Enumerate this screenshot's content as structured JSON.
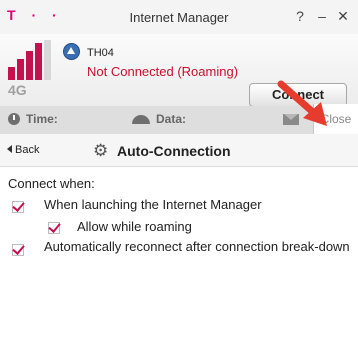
{
  "window": {
    "brand": "T · ·",
    "title": "Internet Manager",
    "help": "?",
    "minimize": "–",
    "close": "✕"
  },
  "status": {
    "technology": "4G",
    "network_name": "TH04",
    "connection_status": "Not Connected (Roaming)",
    "connect_label": "Connect",
    "signal_bars": 4,
    "accent": "#c4124f"
  },
  "info": {
    "time_label": "Time:",
    "data_label": "Data:",
    "close_label": "Close"
  },
  "nav": {
    "back_label": "Back",
    "title": "Auto-Connection"
  },
  "settings": {
    "heading": "Connect when:",
    "options": [
      {
        "label": "When launching the Internet Manager",
        "checked": true
      },
      {
        "label": "Allow while roaming",
        "checked": true
      },
      {
        "label": "Automatically reconnect after connection break-down",
        "checked": true
      }
    ]
  }
}
